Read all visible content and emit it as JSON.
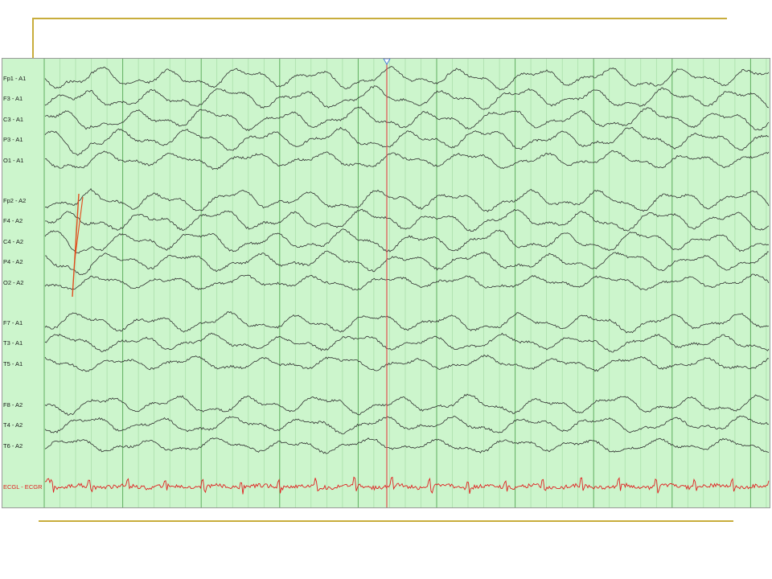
{
  "viewer": {
    "channels": [
      {
        "label": "Fp1 - A1",
        "group": 1,
        "color": "#303030"
      },
      {
        "label": "F3 - A1",
        "group": 1,
        "color": "#303030"
      },
      {
        "label": "C3 - A1",
        "group": 1,
        "color": "#303030"
      },
      {
        "label": "P3 - A1",
        "group": 1,
        "color": "#303030"
      },
      {
        "label": "O1 - A1",
        "group": 1,
        "color": "#303030"
      },
      {
        "label": "Fp2 - A2",
        "group": 2,
        "color": "#303030"
      },
      {
        "label": "F4 - A2",
        "group": 2,
        "color": "#303030"
      },
      {
        "label": "C4 - A2",
        "group": 2,
        "color": "#303030"
      },
      {
        "label": "P4 - A2",
        "group": 2,
        "color": "#303030"
      },
      {
        "label": "O2 - A2",
        "group": 2,
        "color": "#303030"
      },
      {
        "label": "F7 - A1",
        "group": 3,
        "color": "#303030"
      },
      {
        "label": "T3 - A1",
        "group": 3,
        "color": "#303030"
      },
      {
        "label": "T5 - A1",
        "group": 3,
        "color": "#303030"
      },
      {
        "label": "F8 - A2",
        "group": 4,
        "color": "#303030"
      },
      {
        "label": "T4 - A2",
        "group": 4,
        "color": "#303030"
      },
      {
        "label": "T6 - A2",
        "group": 4,
        "color": "#303030"
      },
      {
        "label": "ECGL - ECGR",
        "group": 5,
        "color": "#e02020"
      }
    ],
    "colors": {
      "background": "#ccf5cc",
      "minor_grid": "#a6dca6",
      "major_grid": "#5fae5f",
      "cursor": "#e05050",
      "cursor_marker": "#4a7fd6",
      "annotation": "#e04a1a",
      "frame": "#c8ad3c"
    }
  }
}
